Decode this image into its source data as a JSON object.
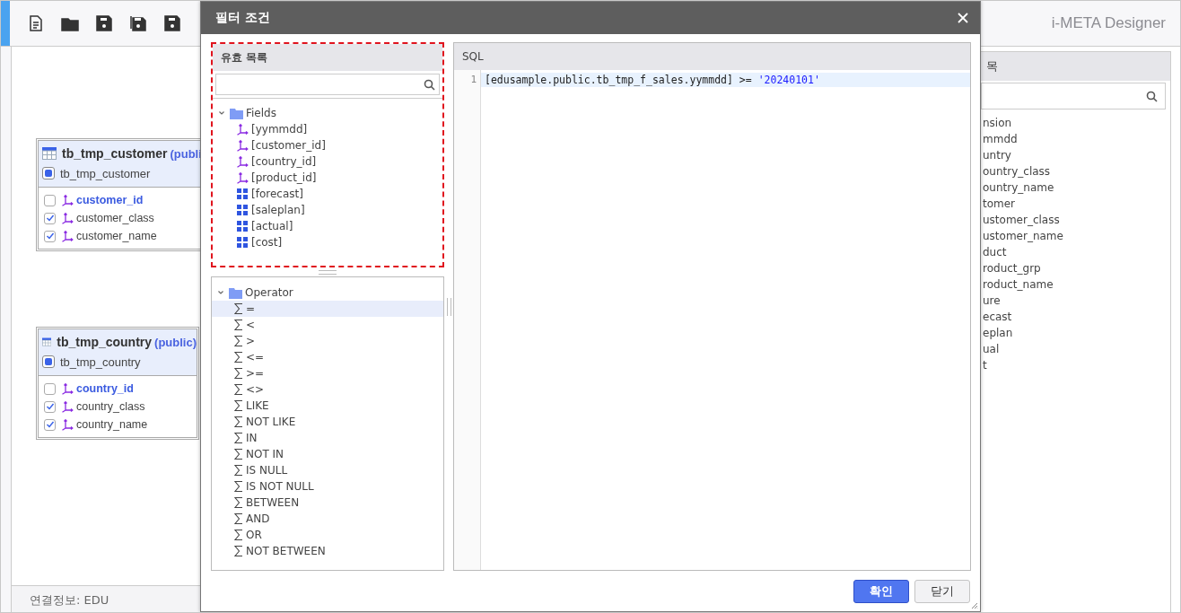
{
  "app_title": "i-META Designer",
  "canvas": {
    "tables": [
      {
        "name": "tb_tmp_customer",
        "schema": "(publi",
        "alias": "tb_tmp_customer",
        "columns": [
          {
            "name": "customer_id",
            "checked": false,
            "key": true
          },
          {
            "name": "customer_class",
            "checked": true,
            "key": false
          },
          {
            "name": "customer_name",
            "checked": true,
            "key": false
          }
        ]
      },
      {
        "name": "tb_tmp_country",
        "schema": "(public)",
        "alias": "tb_tmp_country",
        "columns": [
          {
            "name": "country_id",
            "checked": false,
            "key": true
          },
          {
            "name": "country_class",
            "checked": true,
            "key": false
          },
          {
            "name": "country_name",
            "checked": true,
            "key": false
          }
        ]
      }
    ]
  },
  "status_bar": {
    "text": "연결정보: EDU"
  },
  "right_panel": {
    "title": "목",
    "items": [
      "nsion",
      "mmdd",
      "untry",
      "ountry_class",
      "ountry_name",
      "tomer",
      "ustomer_class",
      "ustomer_name",
      "duct",
      "roduct_grp",
      "roduct_name",
      "ure",
      "ecast",
      "eplan",
      "ual",
      "t"
    ]
  },
  "dialog": {
    "title": "필터 조건",
    "fields_panel": {
      "title": "유효 목록",
      "tree": {
        "label": "Fields",
        "expanded": true,
        "children": [
          {
            "label": "[yymmdd]",
            "kind": "dimension"
          },
          {
            "label": "[customer_id]",
            "kind": "dimension"
          },
          {
            "label": "[country_id]",
            "kind": "dimension"
          },
          {
            "label": "[product_id]",
            "kind": "dimension"
          },
          {
            "label": "[forecast]",
            "kind": "measure"
          },
          {
            "label": "[saleplan]",
            "kind": "measure"
          },
          {
            "label": "[actual]",
            "kind": "measure"
          },
          {
            "label": "[cost]",
            "kind": "measure"
          }
        ]
      }
    },
    "operators": {
      "label": "Operator",
      "expanded": true,
      "children": [
        {
          "label": "=",
          "selected": true
        },
        {
          "label": "<",
          "selected": false
        },
        {
          "label": ">",
          "selected": false
        },
        {
          "label": "<=",
          "selected": false
        },
        {
          "label": ">=",
          "selected": false
        },
        {
          "label": "<>",
          "selected": false
        },
        {
          "label": "LIKE",
          "selected": false
        },
        {
          "label": "NOT LIKE",
          "selected": false
        },
        {
          "label": "IN",
          "selected": false
        },
        {
          "label": "NOT IN",
          "selected": false
        },
        {
          "label": "IS NULL",
          "selected": false
        },
        {
          "label": "IS NOT NULL",
          "selected": false
        },
        {
          "label": "BETWEEN",
          "selected": false
        },
        {
          "label": "AND",
          "selected": false
        },
        {
          "label": "OR",
          "selected": false
        },
        {
          "label": "NOT BETWEEN",
          "selected": false
        }
      ]
    },
    "sql": {
      "title": "SQL",
      "lines": [
        {
          "number": "1",
          "selected": true,
          "tokens": [
            {
              "kind": "plain",
              "text": "[edusample.public.tb_tmp_f_sales.yymmdd] >= "
            },
            {
              "kind": "string",
              "text": "'20240101'"
            }
          ]
        }
      ]
    },
    "buttons": [
      {
        "label": "확인",
        "kind": "primary"
      },
      {
        "label": "닫기",
        "kind": "default"
      }
    ]
  }
}
